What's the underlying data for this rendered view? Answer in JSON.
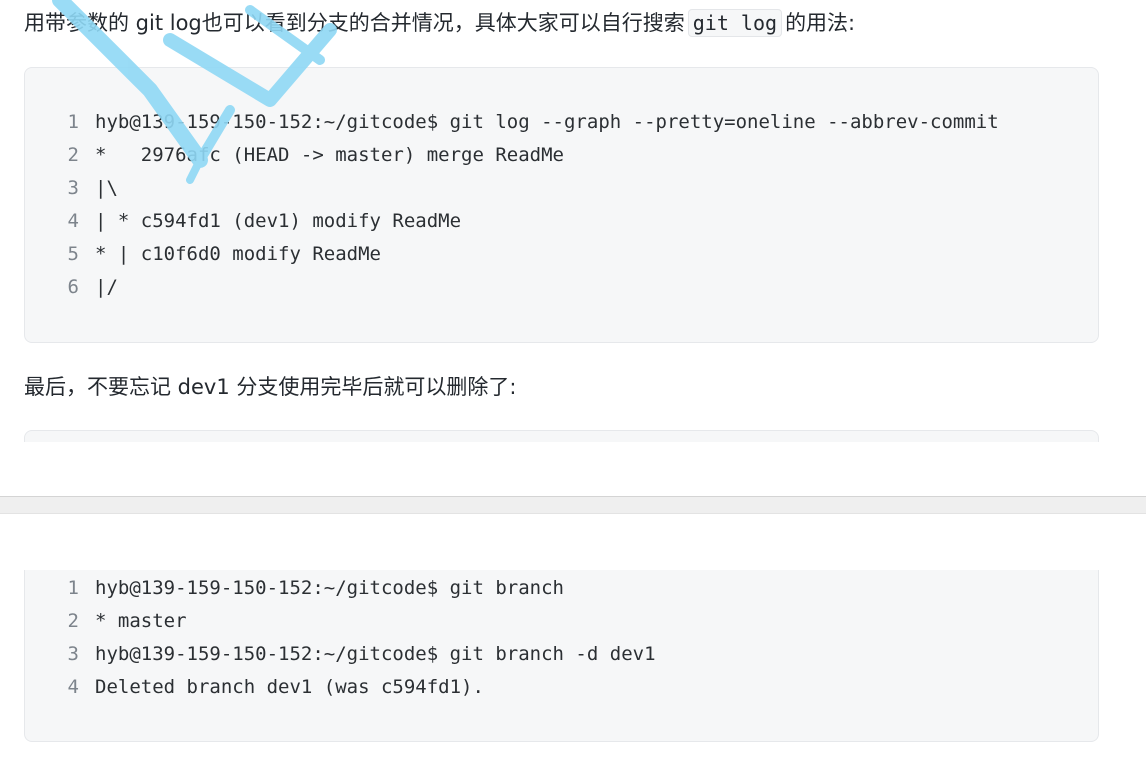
{
  "paragraphs": {
    "first": {
      "before": "用带参数的 git log也可以看到分支的合并情况，具体大家可以自行搜索",
      "code": "git log",
      "after": "的用法:"
    },
    "second": "最后，不要忘记 dev1 分支使用完毕后就可以删除了:"
  },
  "code_block_1": {
    "lines": [
      {
        "num": "1",
        "text": "hyb@139-159-150-152:~/gitcode$ git log --graph --pretty=oneline --abbrev-commit"
      },
      {
        "num": "2",
        "text": "*   2976afc (HEAD -> master) merge ReadMe"
      },
      {
        "num": "3",
        "text": "|\\"
      },
      {
        "num": "4",
        "text": "| * c594fd1 (dev1) modify ReadMe"
      },
      {
        "num": "5",
        "text": "* | c10f6d0 modify ReadMe"
      },
      {
        "num": "6",
        "text": "|/"
      }
    ]
  },
  "code_block_2": {
    "lines": [
      {
        "num": "1",
        "text": "hyb@139-159-150-152:~/gitcode$ git branch"
      },
      {
        "num": "2",
        "text": "* master"
      },
      {
        "num": "3",
        "text": "hyb@139-159-150-152:~/gitcode$ git branch -d dev1"
      },
      {
        "num": "4",
        "text": "Deleted branch dev1 (was c594fd1)."
      }
    ]
  },
  "colors": {
    "code_background": "#f6f7f8",
    "line_number": "#7d848c",
    "watermark": "#8fd8f5"
  }
}
